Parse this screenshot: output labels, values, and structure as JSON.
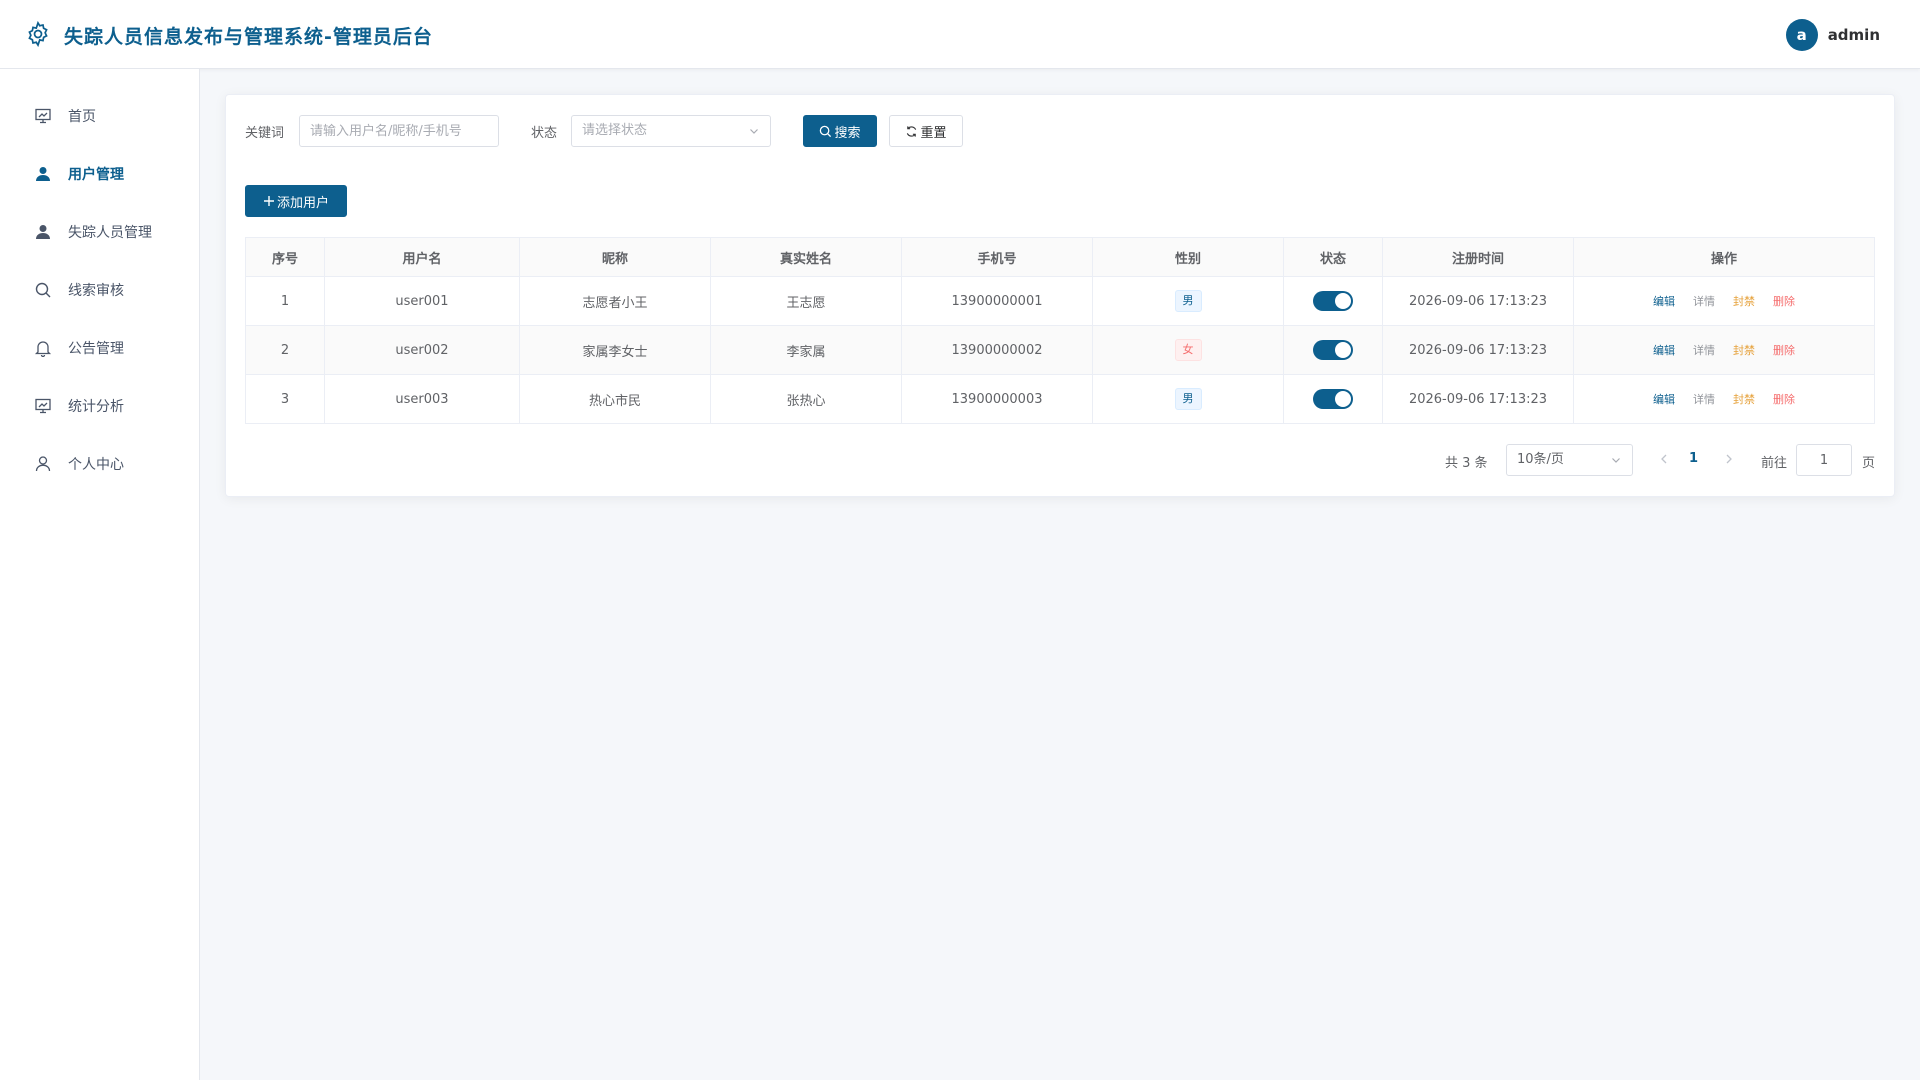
{
  "header": {
    "title": "失踪人员信息发布与管理系统-管理员后台",
    "avatar_letter": "a",
    "username": "admin"
  },
  "sidebar": {
    "items": [
      {
        "label": "首页",
        "icon": "dashboard-icon",
        "active": false
      },
      {
        "label": "用户管理",
        "icon": "user-icon",
        "active": true
      },
      {
        "label": "失踪人员管理",
        "icon": "person-icon",
        "active": false
      },
      {
        "label": "线索审核",
        "icon": "search-icon",
        "active": false
      },
      {
        "label": "公告管理",
        "icon": "bell-icon",
        "active": false
      },
      {
        "label": "统计分析",
        "icon": "chart-icon",
        "active": false
      },
      {
        "label": "个人中心",
        "icon": "profile-icon",
        "active": false
      }
    ]
  },
  "filters": {
    "keyword_label": "关键词",
    "keyword_placeholder": "请输入用户名/昵称/手机号",
    "status_label": "状态",
    "status_placeholder": "请选择状态",
    "search_label": "搜索",
    "reset_label": "重置"
  },
  "toolbar": {
    "add_label": "添加用户"
  },
  "table": {
    "columns": [
      "序号",
      "用户名",
      "昵称",
      "真实姓名",
      "手机号",
      "性别",
      "状态",
      "注册时间",
      "操作"
    ],
    "rows": [
      {
        "index": "1",
        "username": "user001",
        "nickname": "志愿者小王",
        "realname": "王志愿",
        "phone": "13900000001",
        "gender": "男",
        "enabled": true,
        "registered": "2026-09-06 17:13:23"
      },
      {
        "index": "2",
        "username": "user002",
        "nickname": "家属李女士",
        "realname": "李家属",
        "phone": "13900000002",
        "gender": "女",
        "enabled": true,
        "registered": "2026-09-06 17:13:23"
      },
      {
        "index": "3",
        "username": "user003",
        "nickname": "热心市民",
        "realname": "张热心",
        "phone": "13900000003",
        "gender": "男",
        "enabled": true,
        "registered": "2026-09-06 17:13:23"
      }
    ],
    "actions": {
      "edit": "编辑",
      "detail": "详情",
      "ban": "封禁",
      "delete": "删除"
    }
  },
  "pagination": {
    "total_text": "共 3 条",
    "page_size": "10条/页",
    "current_page": "1",
    "goto_label": "前往",
    "goto_value": "1",
    "page_suffix": "页"
  },
  "colors": {
    "primary": "#0d5f8e",
    "danger": "#f56c6c",
    "warning": "#e6a23c",
    "info": "#909399"
  }
}
